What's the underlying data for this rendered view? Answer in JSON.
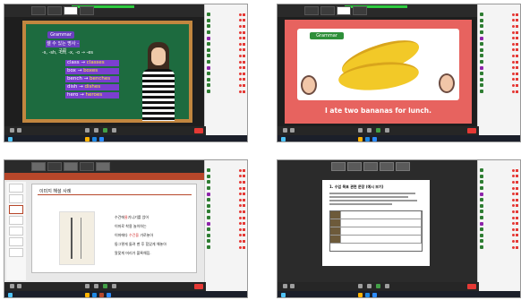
{
  "sidebar": {
    "rows": [
      "",
      "",
      "",
      "",
      "",
      "",
      "",
      "",
      "",
      "",
      "",
      "",
      "",
      ""
    ]
  },
  "panel1": {
    "header_label": "Grammar",
    "badge_label": "셀 수 있는 명사 -구치",
    "rule_text": "-s, -sh, -ch, -x, -o → -es",
    "examples": [
      {
        "from": "class",
        "to": "classes"
      },
      {
        "from": "box",
        "to": "boxes"
      },
      {
        "from": "bench",
        "to": "benches"
      },
      {
        "from": "dish",
        "to": "dishes"
      },
      {
        "from": "hero",
        "to": "heroes"
      }
    ]
  },
  "panel2": {
    "tag_label": "Grammar",
    "caption": "I ate two bananas for lunch."
  },
  "panel3": {
    "slide_title": "이미지 해설 사례",
    "lines": [
      {
        "pre": "수건에",
        "hl": "물",
        "post": "기니기를 얹어"
      },
      {
        "pre": "이마로 착용 놀이하는",
        "hl": "",
        "post": ""
      },
      {
        "pre": "이마에다 ",
        "hl": "수건을",
        "post": " 가로놓아"
      },
      {
        "pre": "둥그렇게 돌려 맨 후 힘있게 해놓아",
        "hl": "",
        "post": ""
      },
      {
        "pre": "알맞게 머리가 볼록해짐.",
        "hl": "",
        "post": ""
      }
    ]
  },
  "panel4": {
    "doc_title": "1. 수업 목표 관련 문장 (예시 보기)"
  },
  "colors": {
    "accent_purple": "#6a3fbf",
    "leave_red": "#e53935",
    "flash_red": "#e7635f",
    "ppt_orange": "#b7472a"
  }
}
